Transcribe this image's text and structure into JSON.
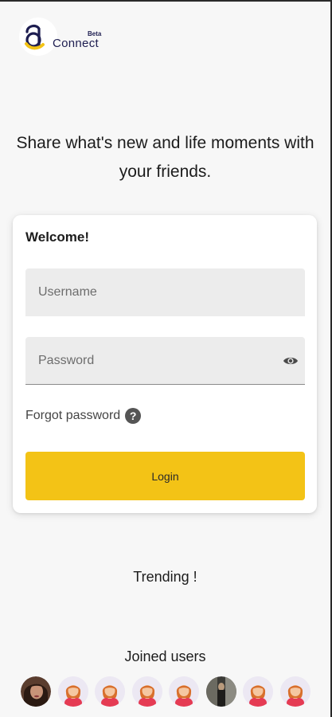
{
  "logo": {
    "beta": "Beta",
    "name": "Connect"
  },
  "tagline": "Share what's new and life moments with your friends.",
  "login_card": {
    "welcome": "Welcome!",
    "username_placeholder": "Username",
    "password_placeholder": "Password",
    "forgot_password": "Forgot password",
    "help_icon": "?",
    "login_button": "Login"
  },
  "trending_label": "Trending !",
  "joined_users": {
    "label": "Joined users",
    "avatars": [
      {
        "type": "photo",
        "name": "user-photo-1"
      },
      {
        "type": "default",
        "name": "default-avatar"
      },
      {
        "type": "default",
        "name": "default-avatar"
      },
      {
        "type": "default",
        "name": "default-avatar"
      },
      {
        "type": "default",
        "name": "default-avatar"
      },
      {
        "type": "photo",
        "name": "user-photo-2"
      },
      {
        "type": "default",
        "name": "default-avatar"
      },
      {
        "type": "default",
        "name": "default-avatar"
      }
    ]
  },
  "colors": {
    "accent": "#f3c316",
    "logo_text": "#1d1d50",
    "background": "#f7f7f7"
  }
}
